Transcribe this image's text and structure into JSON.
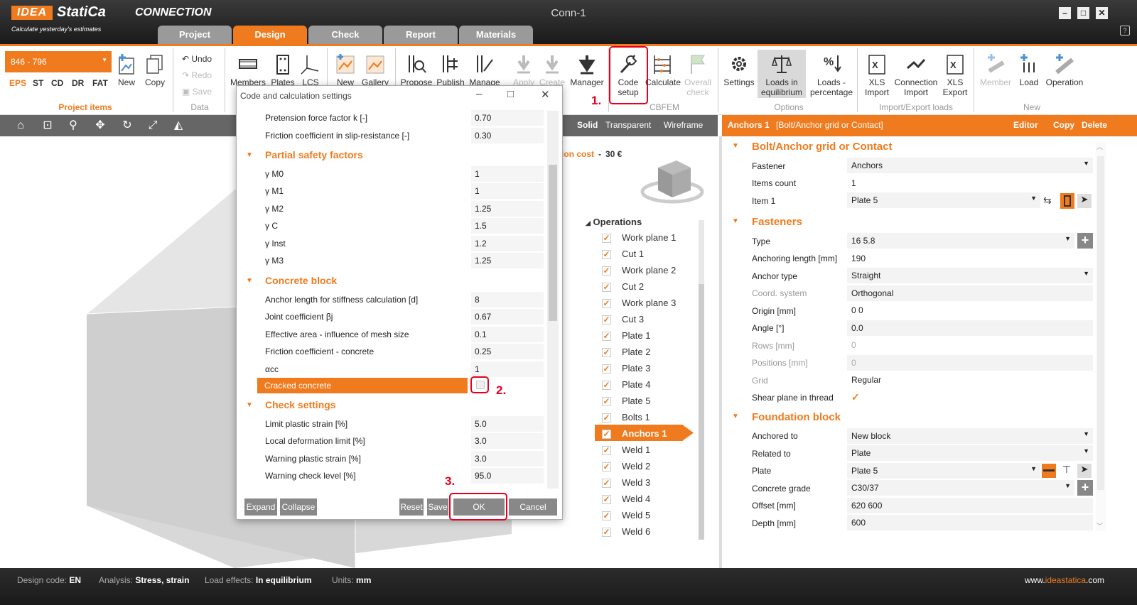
{
  "app": {
    "logo": "IDEA",
    "brand": "StatiCa",
    "product": "CONNECTION",
    "tagline": "Calculate yesterday's estimates",
    "window_title": "Conn-1",
    "tabs": [
      "Project",
      "Design",
      "Check",
      "Report",
      "Materials"
    ],
    "active_tab": "Design",
    "colors": {
      "accent": "#f07b1e",
      "annotation": "#e6001e"
    }
  },
  "ribbon": {
    "project_item": "846 - 796",
    "codes": [
      "EPS",
      "ST",
      "CD",
      "DR",
      "FAT"
    ],
    "new_label": "New",
    "copy_label": "Copy",
    "project_items_group": "Project items",
    "undo": "Undo",
    "redo": "Redo",
    "save": "Save",
    "data_group": "Data",
    "members": "Members",
    "plates": "Plates",
    "lcs": "LCS",
    "new2": "New",
    "gallery": "Gallery",
    "propose": "Propose",
    "publish": "Publish",
    "manage": "Manage",
    "apply": "Apply",
    "create": "Create",
    "manager": "Manager",
    "code_setup_1": "Code",
    "code_setup_2": "setup",
    "calculate": "Calculate",
    "overall_1": "Overall",
    "overall_2": "check",
    "cbfem_group": "CBFEM",
    "settings": "Settings",
    "loads_eq_1": "Loads in",
    "loads_eq_2": "equilibrium",
    "loads_pct_1": "Loads -",
    "loads_pct_2": "percentage",
    "options_group": "Options",
    "xls_import_1": "XLS",
    "xls_import_2": "Import",
    "conn_import_1": "Connection",
    "conn_import_2": "Import",
    "xls_export_1": "XLS",
    "xls_export_2": "Export",
    "import_export_group": "Import/Export loads",
    "member": "Member",
    "load": "Load",
    "operation": "Operation",
    "new_group": "New",
    "step1": "1.",
    "step2": "2.",
    "step3": "3."
  },
  "toolbar": {
    "solid": "Solid",
    "transparent": "Transparent",
    "wireframe": "Wireframe",
    "cost_label": "ion cost",
    "cost_dash": "-",
    "cost_value": "30 €"
  },
  "dialog": {
    "title": "Code and calculation settings",
    "rows_top": [
      {
        "label": "Pretension force factor k [-]",
        "value": "0.70"
      },
      {
        "label": "Friction coefficient in slip-resistance [-]",
        "value": "0.30"
      }
    ],
    "section_psf": "Partial safety factors",
    "psf": [
      {
        "label": "γ M0",
        "value": "1"
      },
      {
        "label": "γ M1",
        "value": "1"
      },
      {
        "label": "γ M2",
        "value": "1.25"
      },
      {
        "label": "γ C",
        "value": "1.5"
      },
      {
        "label": "γ Inst",
        "value": "1.2"
      },
      {
        "label": "γ M3",
        "value": "1.25"
      }
    ],
    "section_cb": "Concrete block",
    "cb": [
      {
        "label": "Anchor length for stiffness calculation [d]",
        "value": "8"
      },
      {
        "label": "Joint coefficient βj",
        "value": "0.67"
      },
      {
        "label": "Effective area - influence of mesh size",
        "value": "0.1"
      },
      {
        "label": "Friction coefficient - concrete",
        "value": "0.25"
      },
      {
        "label": "αcc",
        "value": "1"
      }
    ],
    "cracked_label": "Cracked concrete",
    "cracked_checked": false,
    "section_check": "Check settings",
    "check": [
      {
        "label": "Limit plastic strain [%]",
        "value": "5.0"
      },
      {
        "label": "Local deformation limit [%]",
        "value": "3.0"
      },
      {
        "label": "Warning plastic strain [%]",
        "value": "3.0"
      },
      {
        "label": "Warning check level [%]",
        "value": "95.0"
      }
    ],
    "btn_expand": "Expand",
    "btn_collapse": "Collapse",
    "btn_reset": "Reset",
    "btn_save": "Save",
    "btn_ok": "OK",
    "btn_cancel": "Cancel"
  },
  "operations": {
    "header": "Operations",
    "items": [
      "Work plane 1",
      "Cut 1",
      "Work plane 2",
      "Cut 2",
      "Work plane 3",
      "Cut 3",
      "Plate 1",
      "Plate 2",
      "Plate 3",
      "Plate 4",
      "Plate 5",
      "Bolts 1",
      "Anchors 1",
      "Weld 1",
      "Weld 2",
      "Weld 3",
      "Weld 4",
      "Weld 5",
      "Weld 6"
    ],
    "selected": "Anchors 1"
  },
  "panel": {
    "title": "Anchors 1",
    "subtitle": "[Bolt/Anchor grid or Contact]",
    "editor": "Editor",
    "copy": "Copy",
    "delete": "Delete",
    "sec1": "Bolt/Anchor grid or Contact",
    "fastener_label": "Fastener",
    "fastener_value": "Anchors",
    "items_count_label": "Items count",
    "items_count_value": "1",
    "item1_label": "Item 1",
    "item1_value": "Plate 5",
    "sec2": "Fasteners",
    "type_label": "Type",
    "type_value": "16 5.8",
    "anch_len_label": "Anchoring length [mm]",
    "anch_len_value": "190",
    "anch_type_label": "Anchor type",
    "anch_type_value": "Straight",
    "coord_label": "Coord. system",
    "coord_value": "Orthogonal",
    "origin_label": "Origin [mm]",
    "origin_value": "0 0",
    "angle_label": "Angle [°]",
    "angle_value": "0.0",
    "rows_label": "Rows [mm]",
    "rows_value": "0",
    "positions_label": "Positions [mm]",
    "positions_value": "0",
    "grid_label": "Grid",
    "grid_value": "Regular",
    "shear_label": "Shear plane in thread",
    "shear_checked": true,
    "sec3": "Foundation block",
    "anchored_label": "Anchored to",
    "anchored_value": "New block",
    "related_label": "Related to",
    "related_value": "Plate",
    "plate_label": "Plate",
    "plate_value": "Plate 5",
    "grade_label": "Concrete grade",
    "grade_value": "C30/37",
    "offset_label": "Offset [mm]",
    "offset_value": "620 600",
    "depth_label": "Depth [mm]",
    "depth_value": "600"
  },
  "status": {
    "design_code_label": "Design code:",
    "design_code": "EN",
    "analysis_label": "Analysis:",
    "analysis": "Stress, strain",
    "load_effects_label": "Load effects:",
    "load_effects": "In equilibrium",
    "units_label": "Units:",
    "units": "mm",
    "website_pre": "www.",
    "website_brand": "ideastatica",
    "website_post": ".com"
  }
}
